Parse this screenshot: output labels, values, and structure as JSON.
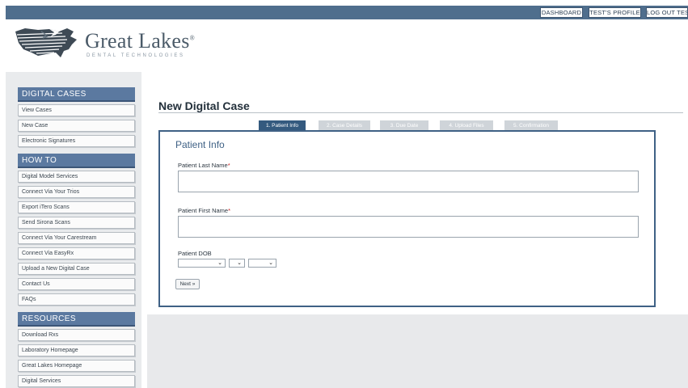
{
  "header": {
    "dashboard_label": "DASHBOARD",
    "profile_label": "TEST'S PROFILE",
    "logout_label": "LOG OUT TEST"
  },
  "brand": {
    "name": "Great Lakes",
    "registered_mark": "®",
    "tagline": "DENTAL TECHNOLOGIES",
    "logo_icon": "usa-map-logo-icon"
  },
  "sidebar": {
    "sections": [
      {
        "title": "DIGITAL CASES",
        "items": [
          "View Cases",
          "New Case",
          "Electronic Signatures"
        ]
      },
      {
        "title": "HOW TO",
        "items": [
          "Digital Model Services",
          "Connect Via Your Trios",
          "Export iTero Scans",
          "Send Sirona Scans",
          "Connect Via Your Carestream",
          "Connect Via EasyRx",
          "Upload a New Digital Case",
          "Contact Us",
          "FAQs"
        ]
      },
      {
        "title": "RESOURCES",
        "items": [
          "Download Rxs",
          "Laboratory Homepage",
          "Great Lakes Homepage",
          "Digital Services"
        ]
      }
    ]
  },
  "main": {
    "page_title": "New Digital Case",
    "steps": [
      "1. Patient Info",
      "2. Case Details",
      "3. Due Date",
      "4. Upload Files",
      "5. Confirmation"
    ],
    "active_step": 0,
    "form": {
      "title": "Patient Info",
      "last_name_label": "Patient Last Name",
      "last_name_value": "",
      "first_name_label": "Patient First Name",
      "first_name_value": "",
      "required_mark": "*",
      "dob_label": "Patient DOB",
      "next_label": "Next »"
    }
  },
  "colors": {
    "topbar": "#4f6e8d",
    "section_header": "#5b79a0",
    "active_step": "#345a7f",
    "inactive_step": "#cfd4d9",
    "form_border": "#3f6185",
    "required": "#c81e1e"
  }
}
